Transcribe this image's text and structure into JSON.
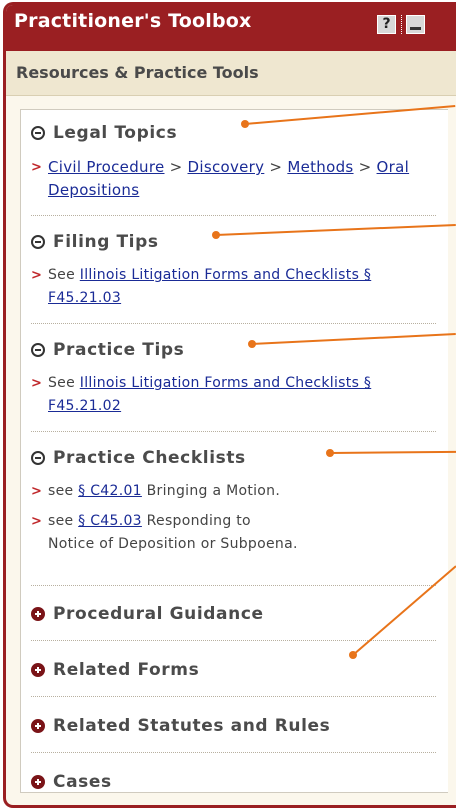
{
  "panel": {
    "title": "Practitioner's Toolbox",
    "help_icon_label": "?",
    "subhead": "Resources & Practice Tools"
  },
  "sections": [
    {
      "title": "Legal Topics",
      "state": "expanded"
    },
    {
      "title": "Filing Tips",
      "state": "expanded"
    },
    {
      "title": "Practice Tips",
      "state": "expanded"
    },
    {
      "title": "Practice Checklists",
      "state": "expanded"
    },
    {
      "title": "Procedural Guidance",
      "state": "collapsed"
    },
    {
      "title": "Related Forms",
      "state": "collapsed"
    },
    {
      "title": "Related Statutes and Rules",
      "state": "collapsed"
    },
    {
      "title": "Cases",
      "state": "collapsed"
    }
  ],
  "legal_topics": {
    "bullet": ">",
    "link1": "Civil Procedure",
    "sep1": " > ",
    "link2": "Discovery",
    "sep2": " > ",
    "link3": "Methods",
    "sep3": " > ",
    "link4": "Oral Depositions"
  },
  "filing_tips": {
    "bullet": ">",
    "prefix": "See ",
    "link": "Illinois Litigation Forms and Checklists § F45.21.03"
  },
  "practice_tips": {
    "bullet": ">",
    "prefix": "See ",
    "link": "Illinois Litigation Forms and Checklists § F45.21.02"
  },
  "practice_checklists": [
    {
      "bullet": ">",
      "prefix": "see ",
      "link": "§ C42.01",
      "suffix": " Bringing a Motion."
    },
    {
      "bullet": ">",
      "prefix": "see ",
      "link": "§ C45.03",
      "suffix": " Responding to Notice of Deposition or Subpoena."
    }
  ],
  "colors": {
    "title_bar": "#9a1f22",
    "link": "#1a2b96",
    "bullet": "#c0282b",
    "callout": "#e8741a",
    "panel_bg": "#fbf7ec"
  },
  "icons": {
    "help": "help-icon",
    "minimize": "minimize-icon",
    "expanded": "minus-circle-icon",
    "collapsed": "plus-circle-icon"
  }
}
